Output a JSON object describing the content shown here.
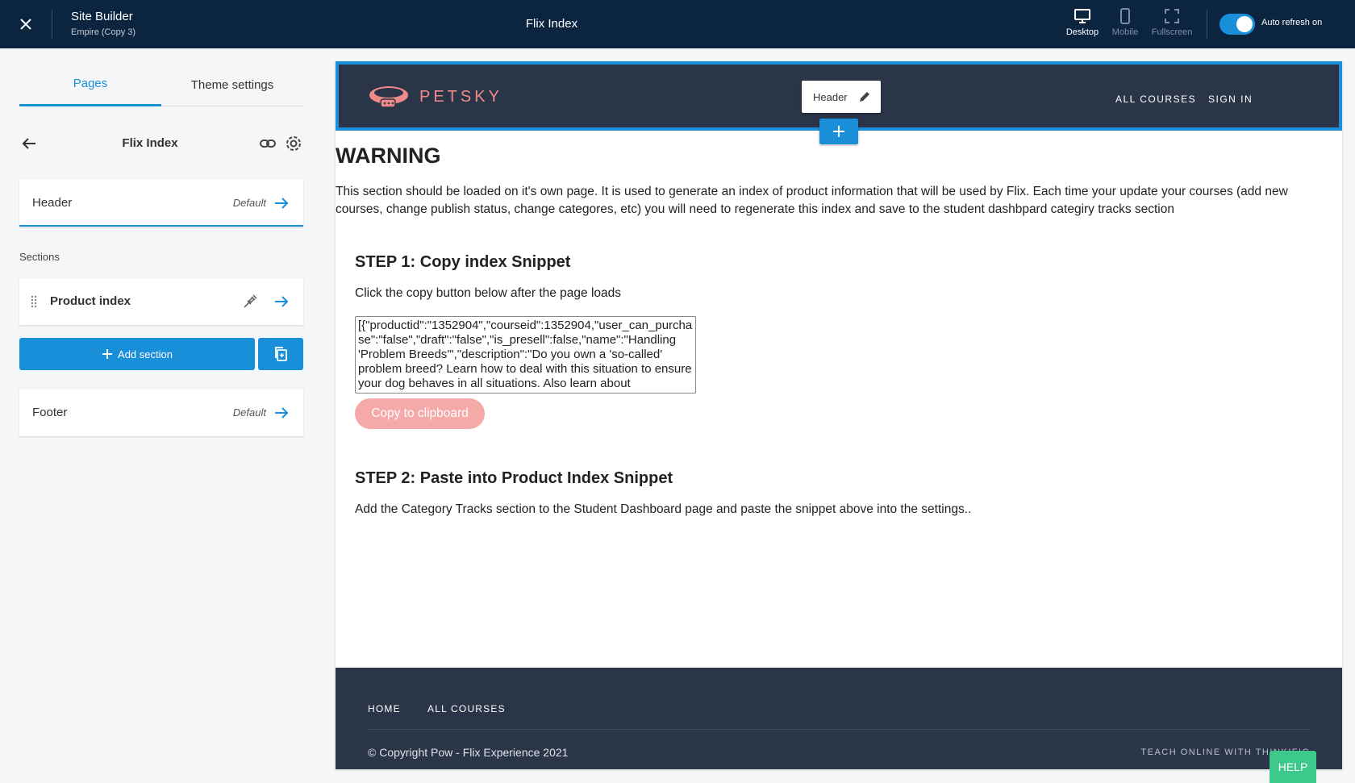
{
  "topbar": {
    "app_title": "Site Builder",
    "app_subtitle": "Empire (Copy 3)",
    "page_title": "Flix Index",
    "views": [
      {
        "label": "Desktop",
        "icon": "desktop-icon",
        "active": true
      },
      {
        "label": "Mobile",
        "icon": "mobile-icon",
        "active": false
      },
      {
        "label": "Fullscreen",
        "icon": "fullscreen-icon",
        "active": false
      }
    ],
    "auto_refresh_label": "Auto refresh on",
    "auto_refresh_on": true
  },
  "sidebar": {
    "tabs": [
      {
        "label": "Pages",
        "active": true
      },
      {
        "label": "Theme settings",
        "active": false
      }
    ],
    "page_name": "Flix Index",
    "header_card": {
      "label": "Header",
      "tag": "Default"
    },
    "sections_label": "Sections",
    "sections": [
      {
        "label": "Product index"
      }
    ],
    "add_section_label": "Add section",
    "footer_card": {
      "label": "Footer",
      "tag": "Default"
    }
  },
  "preview": {
    "logo_text": "PETSKY",
    "header_chip_label": "Header",
    "nav": [
      "ALL COURSES",
      "SIGN IN"
    ],
    "warning_title": "WARNING",
    "warning_text": "This section should be loaded on it's own page. It is used to generate an index of product information that will be used by Flix. Each time your update your courses (add new courses, change publish status, change categores, etc) you will need to regenerate this index and save to the student dashbpard categiry tracks section",
    "step1_title": "STEP 1: Copy index Snippet",
    "step1_text": "Click the copy button below after the page loads",
    "snippet_value": "[{\"productid\":\"1352904\",\"courseid\":1352904,\"user_can_purchase\":\"false\",\"draft\":\"false\",\"is_presell\":false,\"name\":\"Handling 'Problem Breeds'\",\"description\":\"Do you own a 'so-called' problem breed? Learn how to deal with this situation to ensure your dog behaves in all situations. Also learn about",
    "copy_button_label": "Copy to clipboard",
    "step2_title": "STEP 2: Paste into Product Index Snippet",
    "step2_text": "Add the Category Tracks section to the Student Dashboard page and paste the snippet above into the settings..",
    "footer_nav": [
      "HOME",
      "ALL COURSES"
    ],
    "copyright": "© Copyright Pow - Flix Experience 2021",
    "teach_text": "TEACH ONLINE WITH THINKIFIC"
  },
  "help_label": "HELP",
  "colors": {
    "topbar_bg": "#0b2440",
    "accent": "#1a8fd9",
    "site_dark": "#2a3547",
    "brand_pink": "#f08a8a",
    "copy_button": "#f6a9a9",
    "help_green": "#3ec98c"
  }
}
